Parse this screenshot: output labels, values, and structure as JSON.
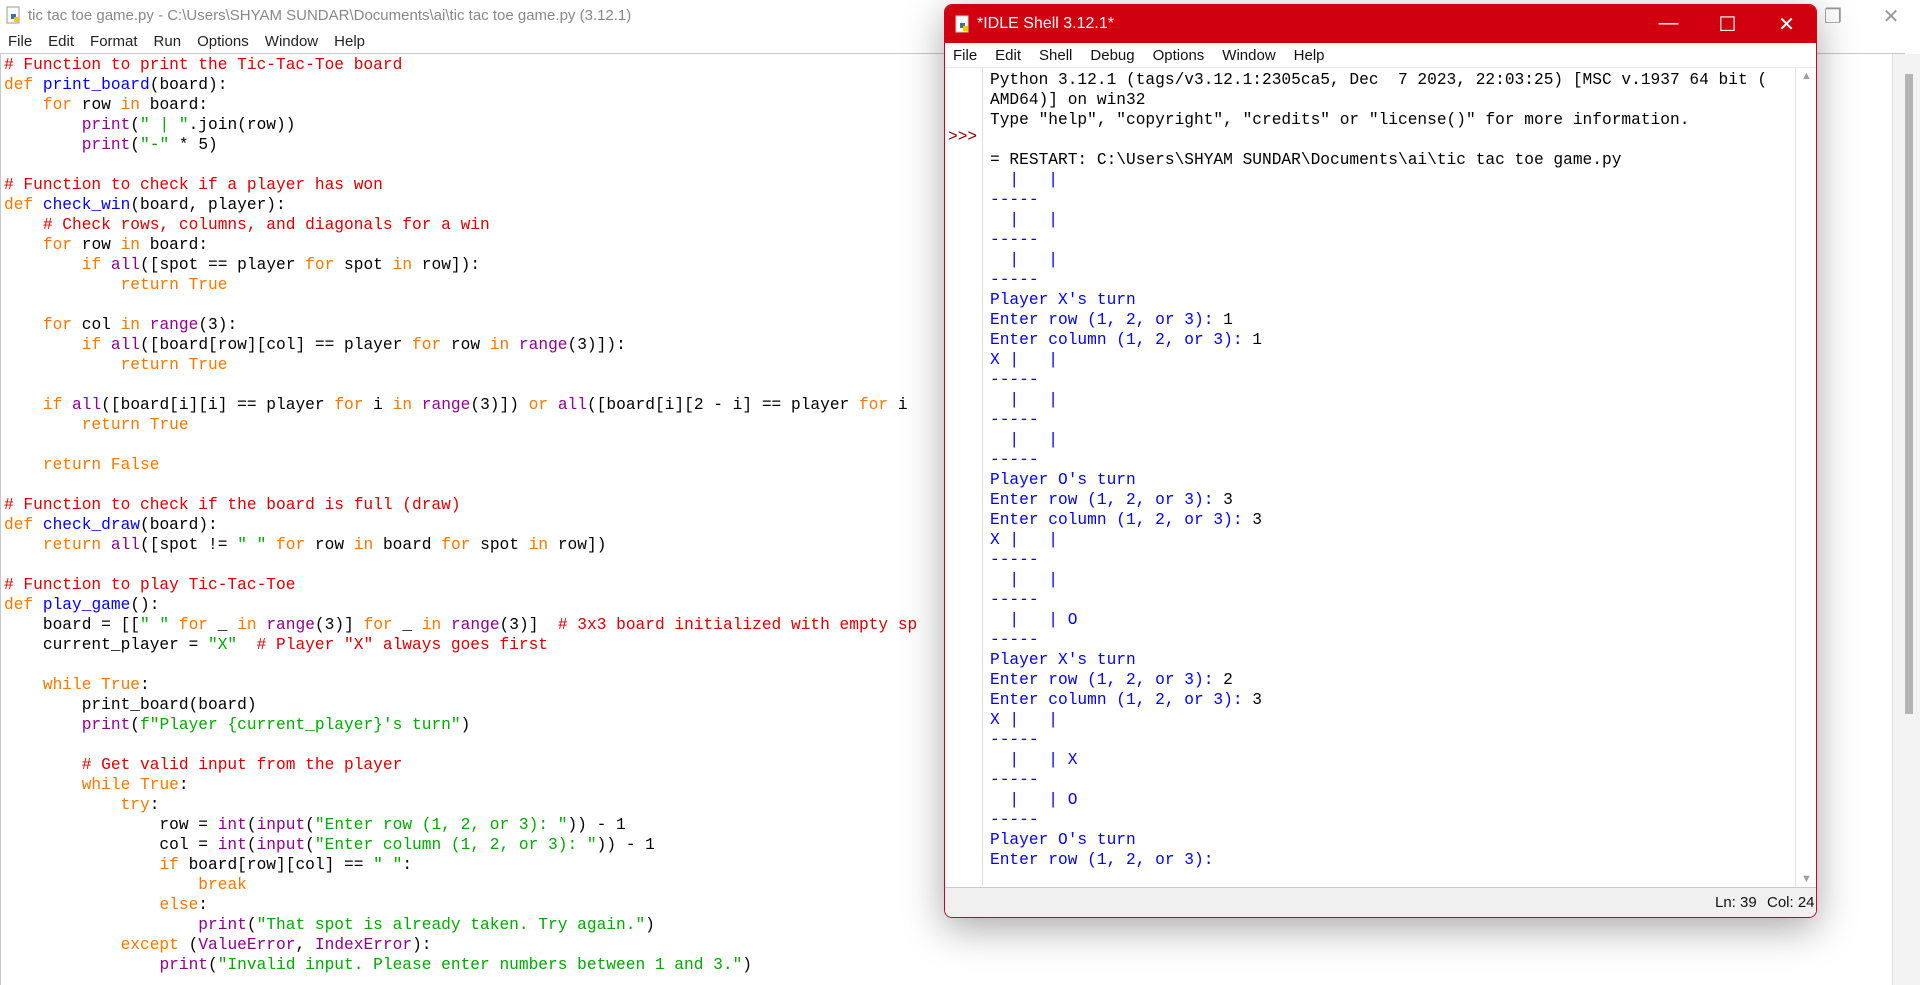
{
  "editor": {
    "title": "tic tac toe game.py - C:\\Users\\SHYAM SUNDAR\\Documents\\ai\\tic tac toe game.py (3.12.1)",
    "menu": [
      "File",
      "Edit",
      "Format",
      "Run",
      "Options",
      "Window",
      "Help"
    ],
    "window_buttons": {
      "restore": "restore-icon",
      "close": "close-icon"
    },
    "lines": [
      [
        [
          "c",
          "# Function to print the Tic-Tac-Toe board"
        ]
      ],
      [
        [
          "k",
          "def"
        ],
        [
          "n",
          " "
        ],
        [
          "d",
          "print_board"
        ],
        [
          "n",
          "(board):"
        ]
      ],
      [
        [
          "n",
          "    "
        ],
        [
          "k",
          "for"
        ],
        [
          "n",
          " row "
        ],
        [
          "k",
          "in"
        ],
        [
          "n",
          " board:"
        ]
      ],
      [
        [
          "n",
          "        "
        ],
        [
          "b",
          "print"
        ],
        [
          "n",
          "("
        ],
        [
          "s",
          "\" | \""
        ],
        [
          "n",
          ".join(row))"
        ]
      ],
      [
        [
          "n",
          "        "
        ],
        [
          "b",
          "print"
        ],
        [
          "n",
          "("
        ],
        [
          "s",
          "\"-\""
        ],
        [
          "n",
          " * 5)"
        ]
      ],
      [],
      [
        [
          "c",
          "# Function to check if a player has won"
        ]
      ],
      [
        [
          "k",
          "def"
        ],
        [
          "n",
          " "
        ],
        [
          "d",
          "check_win"
        ],
        [
          "n",
          "(board, player):"
        ]
      ],
      [
        [
          "n",
          "    "
        ],
        [
          "c",
          "# Check rows, columns, and diagonals for a win"
        ]
      ],
      [
        [
          "n",
          "    "
        ],
        [
          "k",
          "for"
        ],
        [
          "n",
          " row "
        ],
        [
          "k",
          "in"
        ],
        [
          "n",
          " board:"
        ]
      ],
      [
        [
          "n",
          "        "
        ],
        [
          "k",
          "if"
        ],
        [
          "n",
          " "
        ],
        [
          "b",
          "all"
        ],
        [
          "n",
          "([spot == player "
        ],
        [
          "k",
          "for"
        ],
        [
          "n",
          " spot "
        ],
        [
          "k",
          "in"
        ],
        [
          "n",
          " row]):"
        ]
      ],
      [
        [
          "n",
          "            "
        ],
        [
          "k",
          "return"
        ],
        [
          "n",
          " "
        ],
        [
          "k",
          "True"
        ]
      ],
      [],
      [
        [
          "n",
          "    "
        ],
        [
          "k",
          "for"
        ],
        [
          "n",
          " col "
        ],
        [
          "k",
          "in"
        ],
        [
          "n",
          " "
        ],
        [
          "b",
          "range"
        ],
        [
          "n",
          "(3):"
        ]
      ],
      [
        [
          "n",
          "        "
        ],
        [
          "k",
          "if"
        ],
        [
          "n",
          " "
        ],
        [
          "b",
          "all"
        ],
        [
          "n",
          "([board[row][col] == player "
        ],
        [
          "k",
          "for"
        ],
        [
          "n",
          " row "
        ],
        [
          "k",
          "in"
        ],
        [
          "n",
          " "
        ],
        [
          "b",
          "range"
        ],
        [
          "n",
          "(3)]):"
        ]
      ],
      [
        [
          "n",
          "            "
        ],
        [
          "k",
          "return"
        ],
        [
          "n",
          " "
        ],
        [
          "k",
          "True"
        ]
      ],
      [],
      [
        [
          "n",
          "    "
        ],
        [
          "k",
          "if"
        ],
        [
          "n",
          " "
        ],
        [
          "b",
          "all"
        ],
        [
          "n",
          "([board[i][i] == player "
        ],
        [
          "k",
          "for"
        ],
        [
          "n",
          " i "
        ],
        [
          "k",
          "in"
        ],
        [
          "n",
          " "
        ],
        [
          "b",
          "range"
        ],
        [
          "n",
          "(3)]) "
        ],
        [
          "k",
          "or"
        ],
        [
          "n",
          " "
        ],
        [
          "b",
          "all"
        ],
        [
          "n",
          "([board[i][2 - i] == player "
        ],
        [
          "k",
          "for"
        ],
        [
          "n",
          " i"
        ]
      ],
      [
        [
          "n",
          "        "
        ],
        [
          "k",
          "return"
        ],
        [
          "n",
          " "
        ],
        [
          "k",
          "True"
        ]
      ],
      [],
      [
        [
          "n",
          "    "
        ],
        [
          "k",
          "return"
        ],
        [
          "n",
          " "
        ],
        [
          "k",
          "False"
        ]
      ],
      [],
      [
        [
          "c",
          "# Function to check if the board is full (draw)"
        ]
      ],
      [
        [
          "k",
          "def"
        ],
        [
          "n",
          " "
        ],
        [
          "d",
          "check_draw"
        ],
        [
          "n",
          "(board):"
        ]
      ],
      [
        [
          "n",
          "    "
        ],
        [
          "k",
          "return"
        ],
        [
          "n",
          " "
        ],
        [
          "b",
          "all"
        ],
        [
          "n",
          "([spot != "
        ],
        [
          "s",
          "\" \""
        ],
        [
          "n",
          " "
        ],
        [
          "k",
          "for"
        ],
        [
          "n",
          " row "
        ],
        [
          "k",
          "in"
        ],
        [
          "n",
          " board "
        ],
        [
          "k",
          "for"
        ],
        [
          "n",
          " spot "
        ],
        [
          "k",
          "in"
        ],
        [
          "n",
          " row])"
        ]
      ],
      [],
      [
        [
          "c",
          "# Function to play Tic-Tac-Toe"
        ]
      ],
      [
        [
          "k",
          "def"
        ],
        [
          "n",
          " "
        ],
        [
          "d",
          "play_game"
        ],
        [
          "n",
          "():"
        ]
      ],
      [
        [
          "n",
          "    board = [["
        ],
        [
          "s",
          "\" \""
        ],
        [
          "n",
          " "
        ],
        [
          "k",
          "for"
        ],
        [
          "n",
          " _ "
        ],
        [
          "k",
          "in"
        ],
        [
          "n",
          " "
        ],
        [
          "b",
          "range"
        ],
        [
          "n",
          "(3)] "
        ],
        [
          "k",
          "for"
        ],
        [
          "n",
          " _ "
        ],
        [
          "k",
          "in"
        ],
        [
          "n",
          " "
        ],
        [
          "b",
          "range"
        ],
        [
          "n",
          "(3)]  "
        ],
        [
          "c",
          "# 3x3 board initialized with empty sp"
        ]
      ],
      [
        [
          "n",
          "    current_player = "
        ],
        [
          "s",
          "\"X\""
        ],
        [
          "n",
          "  "
        ],
        [
          "c",
          "# Player \"X\" always goes first"
        ]
      ],
      [],
      [
        [
          "n",
          "    "
        ],
        [
          "k",
          "while"
        ],
        [
          "n",
          " "
        ],
        [
          "k",
          "True"
        ],
        [
          "n",
          ":"
        ]
      ],
      [
        [
          "n",
          "        print_board(board)"
        ]
      ],
      [
        [
          "n",
          "        "
        ],
        [
          "b",
          "print"
        ],
        [
          "n",
          "("
        ],
        [
          "s",
          "f\"Player {current_player}'s turn\""
        ],
        [
          "n",
          ")"
        ]
      ],
      [],
      [
        [
          "n",
          "        "
        ],
        [
          "c",
          "# Get valid input from the player"
        ]
      ],
      [
        [
          "n",
          "        "
        ],
        [
          "k",
          "while"
        ],
        [
          "n",
          " "
        ],
        [
          "k",
          "True"
        ],
        [
          "n",
          ":"
        ]
      ],
      [
        [
          "n",
          "            "
        ],
        [
          "k",
          "try"
        ],
        [
          "n",
          ":"
        ]
      ],
      [
        [
          "n",
          "                row = "
        ],
        [
          "b",
          "int"
        ],
        [
          "n",
          "("
        ],
        [
          "b",
          "input"
        ],
        [
          "n",
          "("
        ],
        [
          "s",
          "\"Enter row (1, 2, or 3): \""
        ],
        [
          "n",
          ")) - 1"
        ]
      ],
      [
        [
          "n",
          "                col = "
        ],
        [
          "b",
          "int"
        ],
        [
          "n",
          "("
        ],
        [
          "b",
          "input"
        ],
        [
          "n",
          "("
        ],
        [
          "s",
          "\"Enter column (1, 2, or 3): \""
        ],
        [
          "n",
          ")) - 1"
        ]
      ],
      [
        [
          "n",
          "                "
        ],
        [
          "k",
          "if"
        ],
        [
          "n",
          " board[row][col] == "
        ],
        [
          "s",
          "\" \""
        ],
        [
          "n",
          ":"
        ]
      ],
      [
        [
          "n",
          "                    "
        ],
        [
          "k",
          "break"
        ]
      ],
      [
        [
          "n",
          "                "
        ],
        [
          "k",
          "else"
        ],
        [
          "n",
          ":"
        ]
      ],
      [
        [
          "n",
          "                    "
        ],
        [
          "b",
          "print"
        ],
        [
          "n",
          "("
        ],
        [
          "s",
          "\"That spot is already taken. Try again.\""
        ],
        [
          "n",
          ")"
        ]
      ],
      [
        [
          "n",
          "            "
        ],
        [
          "k",
          "except"
        ],
        [
          "n",
          " ("
        ],
        [
          "b",
          "ValueError"
        ],
        [
          "n",
          ", "
        ],
        [
          "b",
          "IndexError"
        ],
        [
          "n",
          "):"
        ]
      ],
      [
        [
          "n",
          "                "
        ],
        [
          "b",
          "print"
        ],
        [
          "n",
          "("
        ],
        [
          "s",
          "\"Invalid input. Please enter numbers between 1 and 3.\""
        ],
        [
          "n",
          ")"
        ]
      ]
    ]
  },
  "shell": {
    "title": "*IDLE Shell 3.12.1*",
    "menu": [
      "File",
      "Edit",
      "Shell",
      "Debug",
      "Options",
      "Window",
      "Help"
    ],
    "prompt": ">>>",
    "lines": [
      [
        [
          "n",
          "Python 3.12.1 (tags/v3.12.1:2305ca5, Dec  7 2023, 22:03:25) [MSC v.1937 64 bit ("
        ]
      ],
      [
        [
          "n",
          "AMD64)] on win32"
        ]
      ],
      [
        [
          "n",
          "Type \"help\", \"copyright\", \"credits\" or \"license()\" for more information."
        ]
      ],
      [],
      [
        [
          "n",
          "= RESTART: C:\\Users\\SHYAM SUNDAR\\Documents\\ai\\tic tac toe game.py"
        ]
      ],
      [
        [
          "o",
          "  |   |  "
        ]
      ],
      [
        [
          "o",
          "-----"
        ]
      ],
      [
        [
          "o",
          "  |   |  "
        ]
      ],
      [
        [
          "o",
          "-----"
        ]
      ],
      [
        [
          "o",
          "  |   |  "
        ]
      ],
      [
        [
          "o",
          "-----"
        ]
      ],
      [
        [
          "o",
          "Player X's turn"
        ]
      ],
      [
        [
          "o",
          "Enter row (1, 2, or 3): "
        ],
        [
          "i",
          "1"
        ]
      ],
      [
        [
          "o",
          "Enter column (1, 2, or 3): "
        ],
        [
          "i",
          "1"
        ]
      ],
      [
        [
          "o",
          "X |   |  "
        ]
      ],
      [
        [
          "o",
          "-----"
        ]
      ],
      [
        [
          "o",
          "  |   |  "
        ]
      ],
      [
        [
          "o",
          "-----"
        ]
      ],
      [
        [
          "o",
          "  |   |  "
        ]
      ],
      [
        [
          "o",
          "-----"
        ]
      ],
      [
        [
          "o",
          "Player O's turn"
        ]
      ],
      [
        [
          "o",
          "Enter row (1, 2, or 3): "
        ],
        [
          "i",
          "3"
        ]
      ],
      [
        [
          "o",
          "Enter column (1, 2, or 3): "
        ],
        [
          "i",
          "3"
        ]
      ],
      [
        [
          "o",
          "X |   |  "
        ]
      ],
      [
        [
          "o",
          "-----"
        ]
      ],
      [
        [
          "o",
          "  |   |  "
        ]
      ],
      [
        [
          "o",
          "-----"
        ]
      ],
      [
        [
          "o",
          "  |   | O"
        ]
      ],
      [
        [
          "o",
          "-----"
        ]
      ],
      [
        [
          "o",
          "Player X's turn"
        ]
      ],
      [
        [
          "o",
          "Enter row (1, 2, or 3): "
        ],
        [
          "i",
          "2"
        ]
      ],
      [
        [
          "o",
          "Enter column (1, 2, or 3): "
        ],
        [
          "i",
          "3"
        ]
      ],
      [
        [
          "o",
          "X |   |  "
        ]
      ],
      [
        [
          "o",
          "-----"
        ]
      ],
      [
        [
          "o",
          "  |   | X"
        ]
      ],
      [
        [
          "o",
          "-----"
        ]
      ],
      [
        [
          "o",
          "  |   | O"
        ]
      ],
      [
        [
          "o",
          "-----"
        ]
      ],
      [
        [
          "o",
          "Player O's turn"
        ]
      ],
      [
        [
          "o",
          "Enter row (1, 2, or 3): "
        ]
      ]
    ],
    "status": {
      "line": "Ln: 39",
      "col": "Col: 24"
    }
  },
  "colors": {
    "keyword": "#ff7700",
    "builtin": "#900090",
    "string": "#00aa00",
    "comment": "#dd0000",
    "definition": "#0000ff",
    "stdout": "#0000ff",
    "shell_titlebar": "#d1000f"
  }
}
